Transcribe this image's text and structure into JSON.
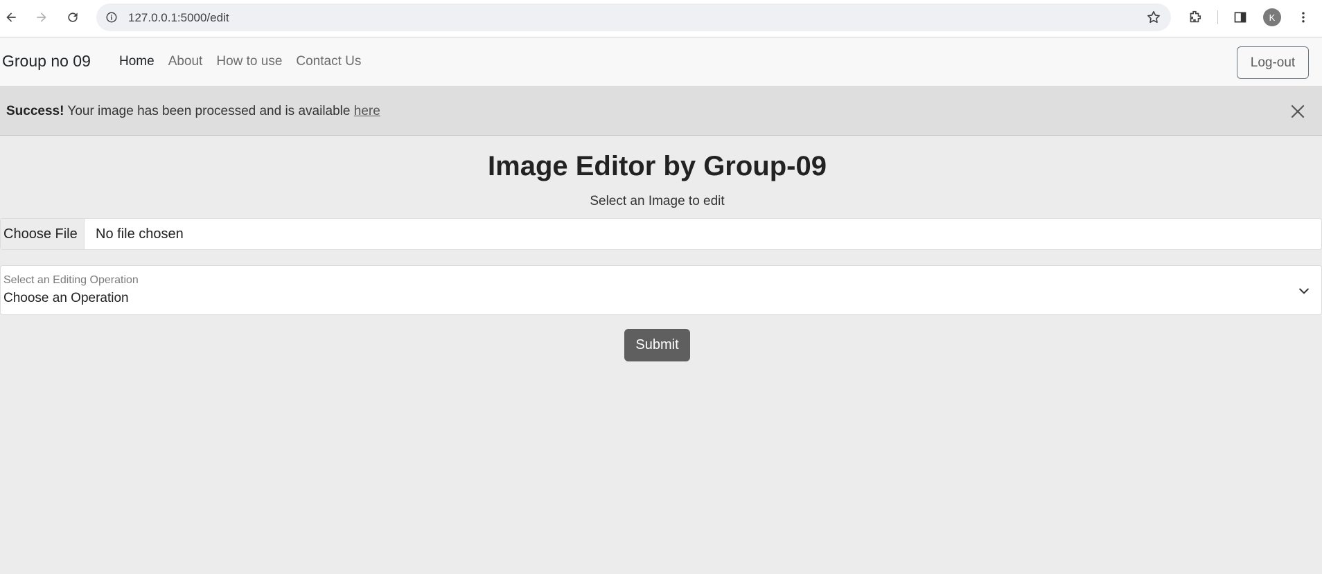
{
  "browser": {
    "url": "127.0.0.1:5000/edit",
    "profile_initial": "K"
  },
  "navbar": {
    "brand": "Group no 09",
    "links": [
      {
        "label": "Home",
        "active": true
      },
      {
        "label": "About",
        "active": false
      },
      {
        "label": "How to use",
        "active": false
      },
      {
        "label": "Contact Us",
        "active": false
      }
    ],
    "logout_label": "Log-out"
  },
  "alert": {
    "strong": "Success!",
    "message": " Your image has been processed and is available ",
    "link_text": "here"
  },
  "main": {
    "title": "Image Editor by Group-09",
    "subtitle": "Select an Image to edit",
    "file_button": "Choose File",
    "file_status": "No file chosen",
    "select_label": "Select an Editing Operation",
    "select_value": "Choose an Operation",
    "submit_label": "Submit"
  },
  "colors": {
    "page_bg": "#ececec",
    "navbar_bg": "#f8f8f8",
    "alert_bg": "#dedede",
    "submit_bg": "#5f5f5f"
  }
}
